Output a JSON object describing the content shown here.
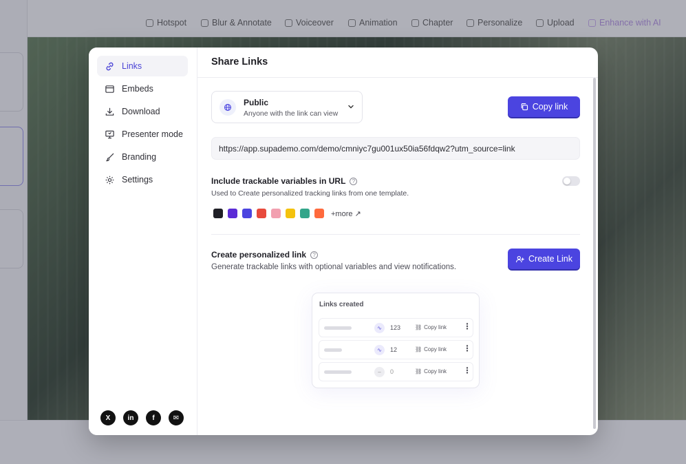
{
  "toolbar": {
    "items": [
      {
        "label": "Hotspot",
        "icon": "hotspot-icon"
      },
      {
        "label": "Blur & Annotate",
        "icon": "blur-icon"
      },
      {
        "label": "Voiceover",
        "icon": "mic-icon"
      },
      {
        "label": "Animation",
        "icon": "animation-icon"
      },
      {
        "label": "Chapter",
        "icon": "chapter-icon"
      },
      {
        "label": "Personalize",
        "icon": "pen-icon"
      },
      {
        "label": "Upload",
        "icon": "upload-icon"
      },
      {
        "label": "Enhance with AI",
        "icon": "sparkle-icon"
      }
    ]
  },
  "sidebar": {
    "items": [
      {
        "label": "Links",
        "icon": "link-icon",
        "active": true
      },
      {
        "label": "Embeds",
        "icon": "embed-icon"
      },
      {
        "label": "Download",
        "icon": "download-icon"
      },
      {
        "label": "Presenter mode",
        "icon": "presenter-icon"
      },
      {
        "label": "Branding",
        "icon": "brush-icon"
      },
      {
        "label": "Settings",
        "icon": "gear-icon"
      }
    ],
    "socials": [
      {
        "label": "X",
        "icon": "x-icon"
      },
      {
        "label": "in",
        "icon": "linkedin-icon"
      },
      {
        "label": "f",
        "icon": "facebook-icon"
      },
      {
        "label": "✉",
        "icon": "mail-icon"
      }
    ]
  },
  "main": {
    "title": "Share Links",
    "access": {
      "title": "Public",
      "subtitle": "Anyone with the link can view"
    },
    "copy_button": "Copy link",
    "url": "https://app.supademo.com/demo/cmniyc7gu001ux50ia56fdqw2?utm_source=link",
    "trackable": {
      "title": "Include trackable variables in URL",
      "description": "Used to Create personalized tracking links from one template.",
      "enabled": false,
      "logos": [
        "#1f1f26",
        "#5b2bd6",
        "#4b44e0",
        "#e84a3c",
        "#f2a0b0",
        "#f4c20d",
        "#33a58a",
        "#ff6a3d"
      ],
      "more_label": "+more ↗"
    },
    "personalized": {
      "title": "Create personalized link",
      "description": "Generate trackable links with optional variables and view notifications.",
      "button": "Create Link"
    },
    "links_created": {
      "title": "Links created",
      "rows": [
        {
          "count": "123",
          "copy": "Copy link",
          "active": true
        },
        {
          "count": "12",
          "copy": "Copy link",
          "active": true
        },
        {
          "count": "0",
          "copy": "Copy link",
          "active": false
        }
      ]
    }
  },
  "colors": {
    "accent": "#4b44e0",
    "active_text": "#4a43d6"
  }
}
